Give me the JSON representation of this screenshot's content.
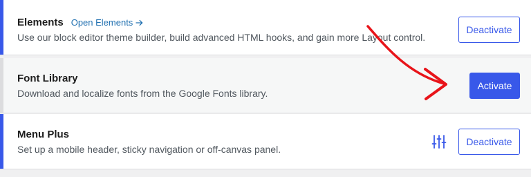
{
  "modules": [
    {
      "name": "Elements",
      "link_label": "Open Elements",
      "link_icon": "arrow-right-icon",
      "description": "Use our block editor theme builder, build advanced HTML hooks, and gain more Layout control.",
      "button_label": "Deactivate",
      "status": "active"
    },
    {
      "name": "Font Library",
      "description": "Download and localize fonts from the Google Fonts library.",
      "button_label": "Activate",
      "status": "inactive"
    },
    {
      "name": "Menu Plus",
      "description": "Set up a mobile header, sticky navigation or off-canvas panel.",
      "settings_icon": "sliders-icon",
      "button_label": "Deactivate",
      "status": "active"
    }
  ],
  "annotation": {
    "icon": "curved-red-arrow",
    "color": "#e8141a"
  },
  "colors": {
    "accent": "#3858e9",
    "link": "#2271b1",
    "inactive_stripe": "#dcdcde"
  }
}
